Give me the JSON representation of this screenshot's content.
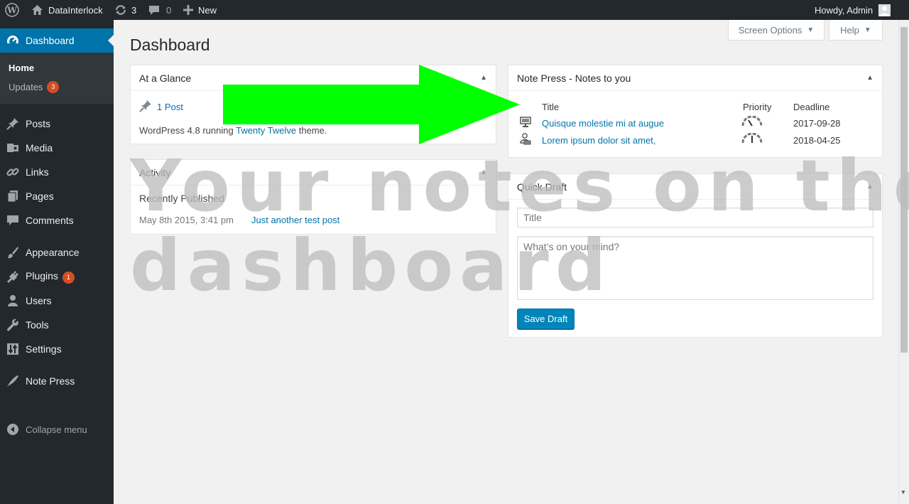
{
  "admin_bar": {
    "site_name": "DataInterlock",
    "updates_count": "3",
    "comments_count": "0",
    "new_label": "New",
    "greeting": "Howdy, Admin"
  },
  "sidebar": {
    "dashboard_label": "Dashboard",
    "submenu": {
      "home": "Home",
      "updates": "Updates",
      "updates_badge": "3"
    },
    "items": [
      {
        "label": "Posts",
        "icon": "pushpin-icon"
      },
      {
        "label": "Media",
        "icon": "media-icon"
      },
      {
        "label": "Links",
        "icon": "link-icon"
      },
      {
        "label": "Pages",
        "icon": "pages-icon"
      },
      {
        "label": "Comments",
        "icon": "comment-icon"
      },
      {
        "label": "Appearance",
        "icon": "paintbrush-icon"
      },
      {
        "label": "Plugins",
        "icon": "plugin-icon",
        "badge": "1"
      },
      {
        "label": "Users",
        "icon": "users-icon"
      },
      {
        "label": "Tools",
        "icon": "wrench-icon"
      },
      {
        "label": "Settings",
        "icon": "settings-icon"
      },
      {
        "label": "Note Press",
        "icon": "pen-icon"
      }
    ],
    "collapse_label": "Collapse menu"
  },
  "header": {
    "screen_options": "Screen Options",
    "help": "Help",
    "page_title": "Dashboard"
  },
  "at_a_glance": {
    "title": "At a Glance",
    "posts": "1 Post",
    "wp_text_before": "WordPress 4.8 running ",
    "theme_link": "Twenty Twelve",
    "wp_text_after": " theme."
  },
  "activity": {
    "title": "Activity",
    "recently_published": "Recently Published",
    "date": "May 8th 2015, 3:41 pm",
    "post_link": "Just another test post"
  },
  "note_press": {
    "title": "Note Press - Notes to you",
    "columns": {
      "title": "Title",
      "priority": "Priority",
      "deadline": "Deadline"
    },
    "rows": [
      {
        "icon": "monitor-icon",
        "title": "Quisque molestie mi at augue",
        "priority_icon": "gauge-icon",
        "deadline": "2017-09-28"
      },
      {
        "icon": "user-desk-icon",
        "title": "Lorem ipsum dolor sit amet,",
        "priority_icon": "gauge-icon",
        "deadline": "2018-04-25"
      }
    ]
  },
  "quick_draft": {
    "title": "Quick Draft",
    "title_placeholder": "Title",
    "content_placeholder": "What’s on your mind?",
    "save_button": "Save Draft"
  },
  "overlay": {
    "line1": "Your notes on the",
    "line2": "dashboard"
  },
  "colors": {
    "admin_dark": "#23282d",
    "accent_blue": "#0073aa",
    "badge_orange": "#d54e21",
    "arrow_green": "#00ff00"
  }
}
